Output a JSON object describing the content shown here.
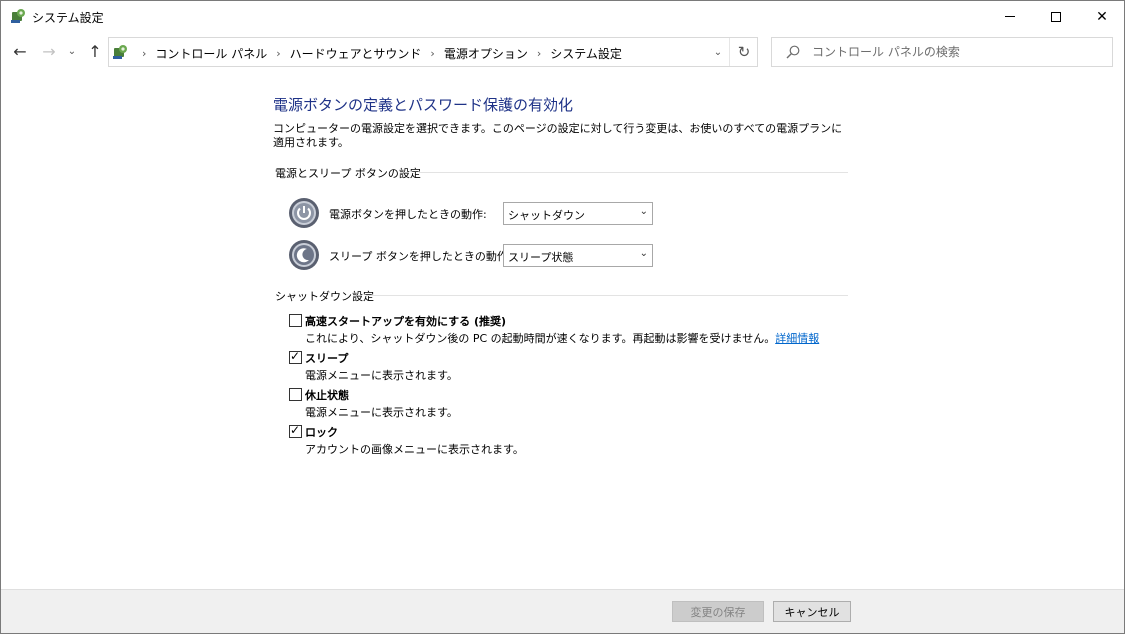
{
  "window": {
    "title": "システム設定",
    "minimize_glyph": "",
    "close_glyph": "✕"
  },
  "nav": {
    "back_glyph": "←",
    "forward_glyph": "→",
    "recent_glyph": "⌄",
    "up_glyph": "↑"
  },
  "address": {
    "crumbs": [
      "コントロール パネル",
      "ハードウェアとサウンド",
      "電源オプション",
      "システム設定"
    ],
    "separator": "›",
    "dropdown_glyph": "⌄",
    "refresh_glyph": "↻"
  },
  "search": {
    "placeholder": "コントロール パネルの検索"
  },
  "page": {
    "title": "電源ボタンの定義とパスワード保護の有効化",
    "description": "コンピューターの電源設定を選択できます。このページの設定に対して行う変更は、お使いのすべての電源プランに適用されます。"
  },
  "power_section": {
    "header": "電源とスリープ ボタンの設定",
    "power_button": {
      "label": "電源ボタンを押したときの動作:",
      "value": "シャットダウン",
      "icon": "power-button-icon"
    },
    "sleep_button": {
      "label": "スリープ ボタンを押したときの動作:",
      "value": "スリープ状態",
      "icon": "sleep-button-icon"
    },
    "chevron": "⌄"
  },
  "shutdown_section": {
    "header": "シャットダウン設定",
    "items": [
      {
        "title": "高速スタートアップを有効にする (推奨)",
        "desc": "これにより、シャットダウン後の PC の起動時間が速くなります。再起動は影響を受けません。",
        "link": "詳細情報",
        "checked": false
      },
      {
        "title": "スリープ",
        "desc": "電源メニューに表示されます。",
        "checked": true
      },
      {
        "title": "休止状態",
        "desc": "電源メニューに表示されます。",
        "checked": false
      },
      {
        "title": "ロック",
        "desc": "アカウントの画像メニューに表示されます。",
        "checked": true
      }
    ],
    "check_glyph": "✓"
  },
  "footer": {
    "save_label": "変更の保存",
    "cancel_label": "キャンセル"
  },
  "colors": {
    "title_blue": "#1e3287",
    "link_blue": "#0066cc",
    "footer_bg": "#f0f0f0"
  }
}
